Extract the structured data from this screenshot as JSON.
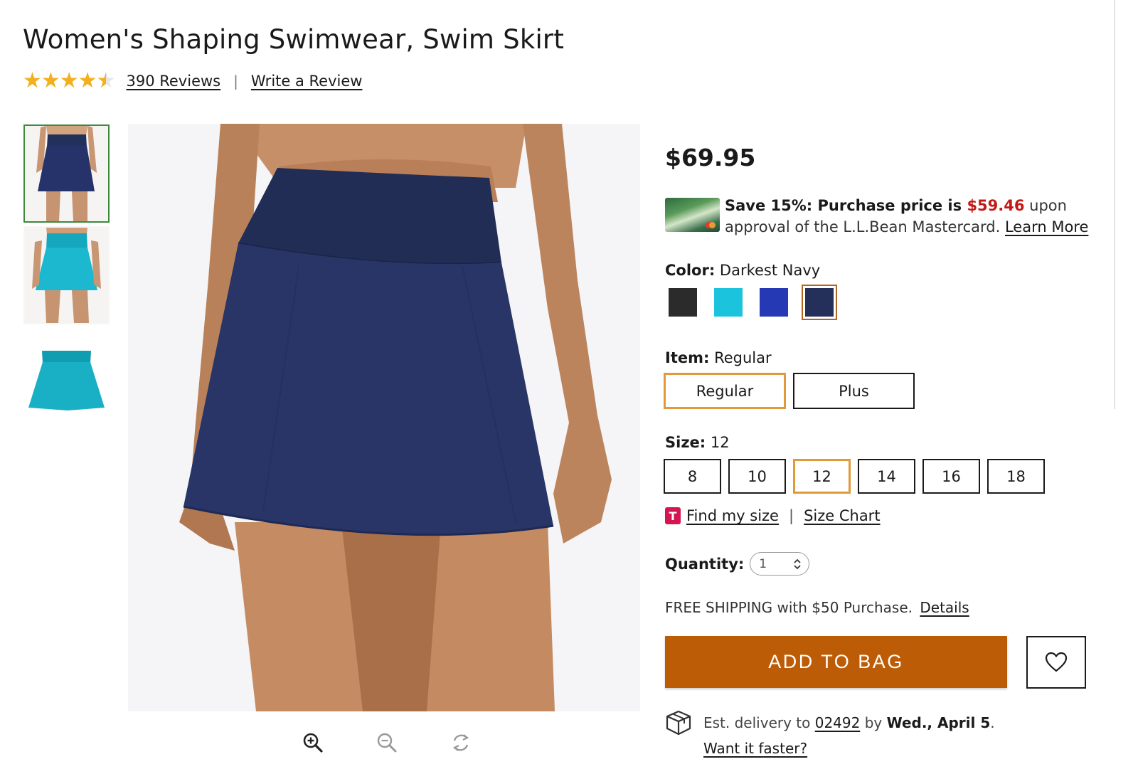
{
  "product": {
    "title": "Women's Shaping Swimwear, Swim Skirt",
    "rating_value": 4.5,
    "rating_max": 5,
    "reviews_label": "390 Reviews",
    "write_review_label": "Write a Review"
  },
  "gallery": {
    "thumbnails": [
      {
        "name": "thumb-darkest-navy",
        "color": "#26305a"
      },
      {
        "name": "thumb-turquoise",
        "color": "#19b3c9"
      },
      {
        "name": "thumb-turquoise-flat",
        "color": "#17aac0"
      }
    ],
    "tools": [
      "zoom-in-icon",
      "zoom-out-icon",
      "rotate-icon"
    ]
  },
  "pricing": {
    "price": "$69.95",
    "promo_bold": "Save 15%: Purchase price is ",
    "promo_price": "$59.46",
    "promo_after": " upon",
    "promo_line2": "approval of the L.L.Bean Mastercard. ",
    "promo_link": "Learn More"
  },
  "color": {
    "label": "Color:",
    "selected": "Darkest Navy",
    "swatches": [
      "#2b2b2b",
      "#1cc3dc",
      "#2639b5",
      "#25305a"
    ]
  },
  "item": {
    "label": "Item:",
    "selected": "Regular",
    "options": [
      "Regular",
      "Plus"
    ]
  },
  "size": {
    "label": "Size:",
    "selected": "12",
    "options": [
      "8",
      "10",
      "12",
      "14",
      "16",
      "18"
    ],
    "tape_icon_letter": "T",
    "find_my_size": "Find my size",
    "size_chart": "Size Chart"
  },
  "quantity": {
    "label": "Quantity:",
    "value": "1"
  },
  "shipping": {
    "text": "FREE SHIPPING with $50 Purchase.",
    "details_link": "Details"
  },
  "actions": {
    "add_to_bag": "ADD TO BAG"
  },
  "delivery": {
    "prefix": "Est. delivery to ",
    "zip": "02492",
    "middle": " by ",
    "date": "Wed., April 5",
    "suffix": ".",
    "faster_link": "Want it faster?"
  },
  "colors": {
    "accent_orange": "#bc5c06",
    "selected_border": "#e09a3b",
    "promo_red": "#c21b17",
    "star": "#f2b01e"
  }
}
